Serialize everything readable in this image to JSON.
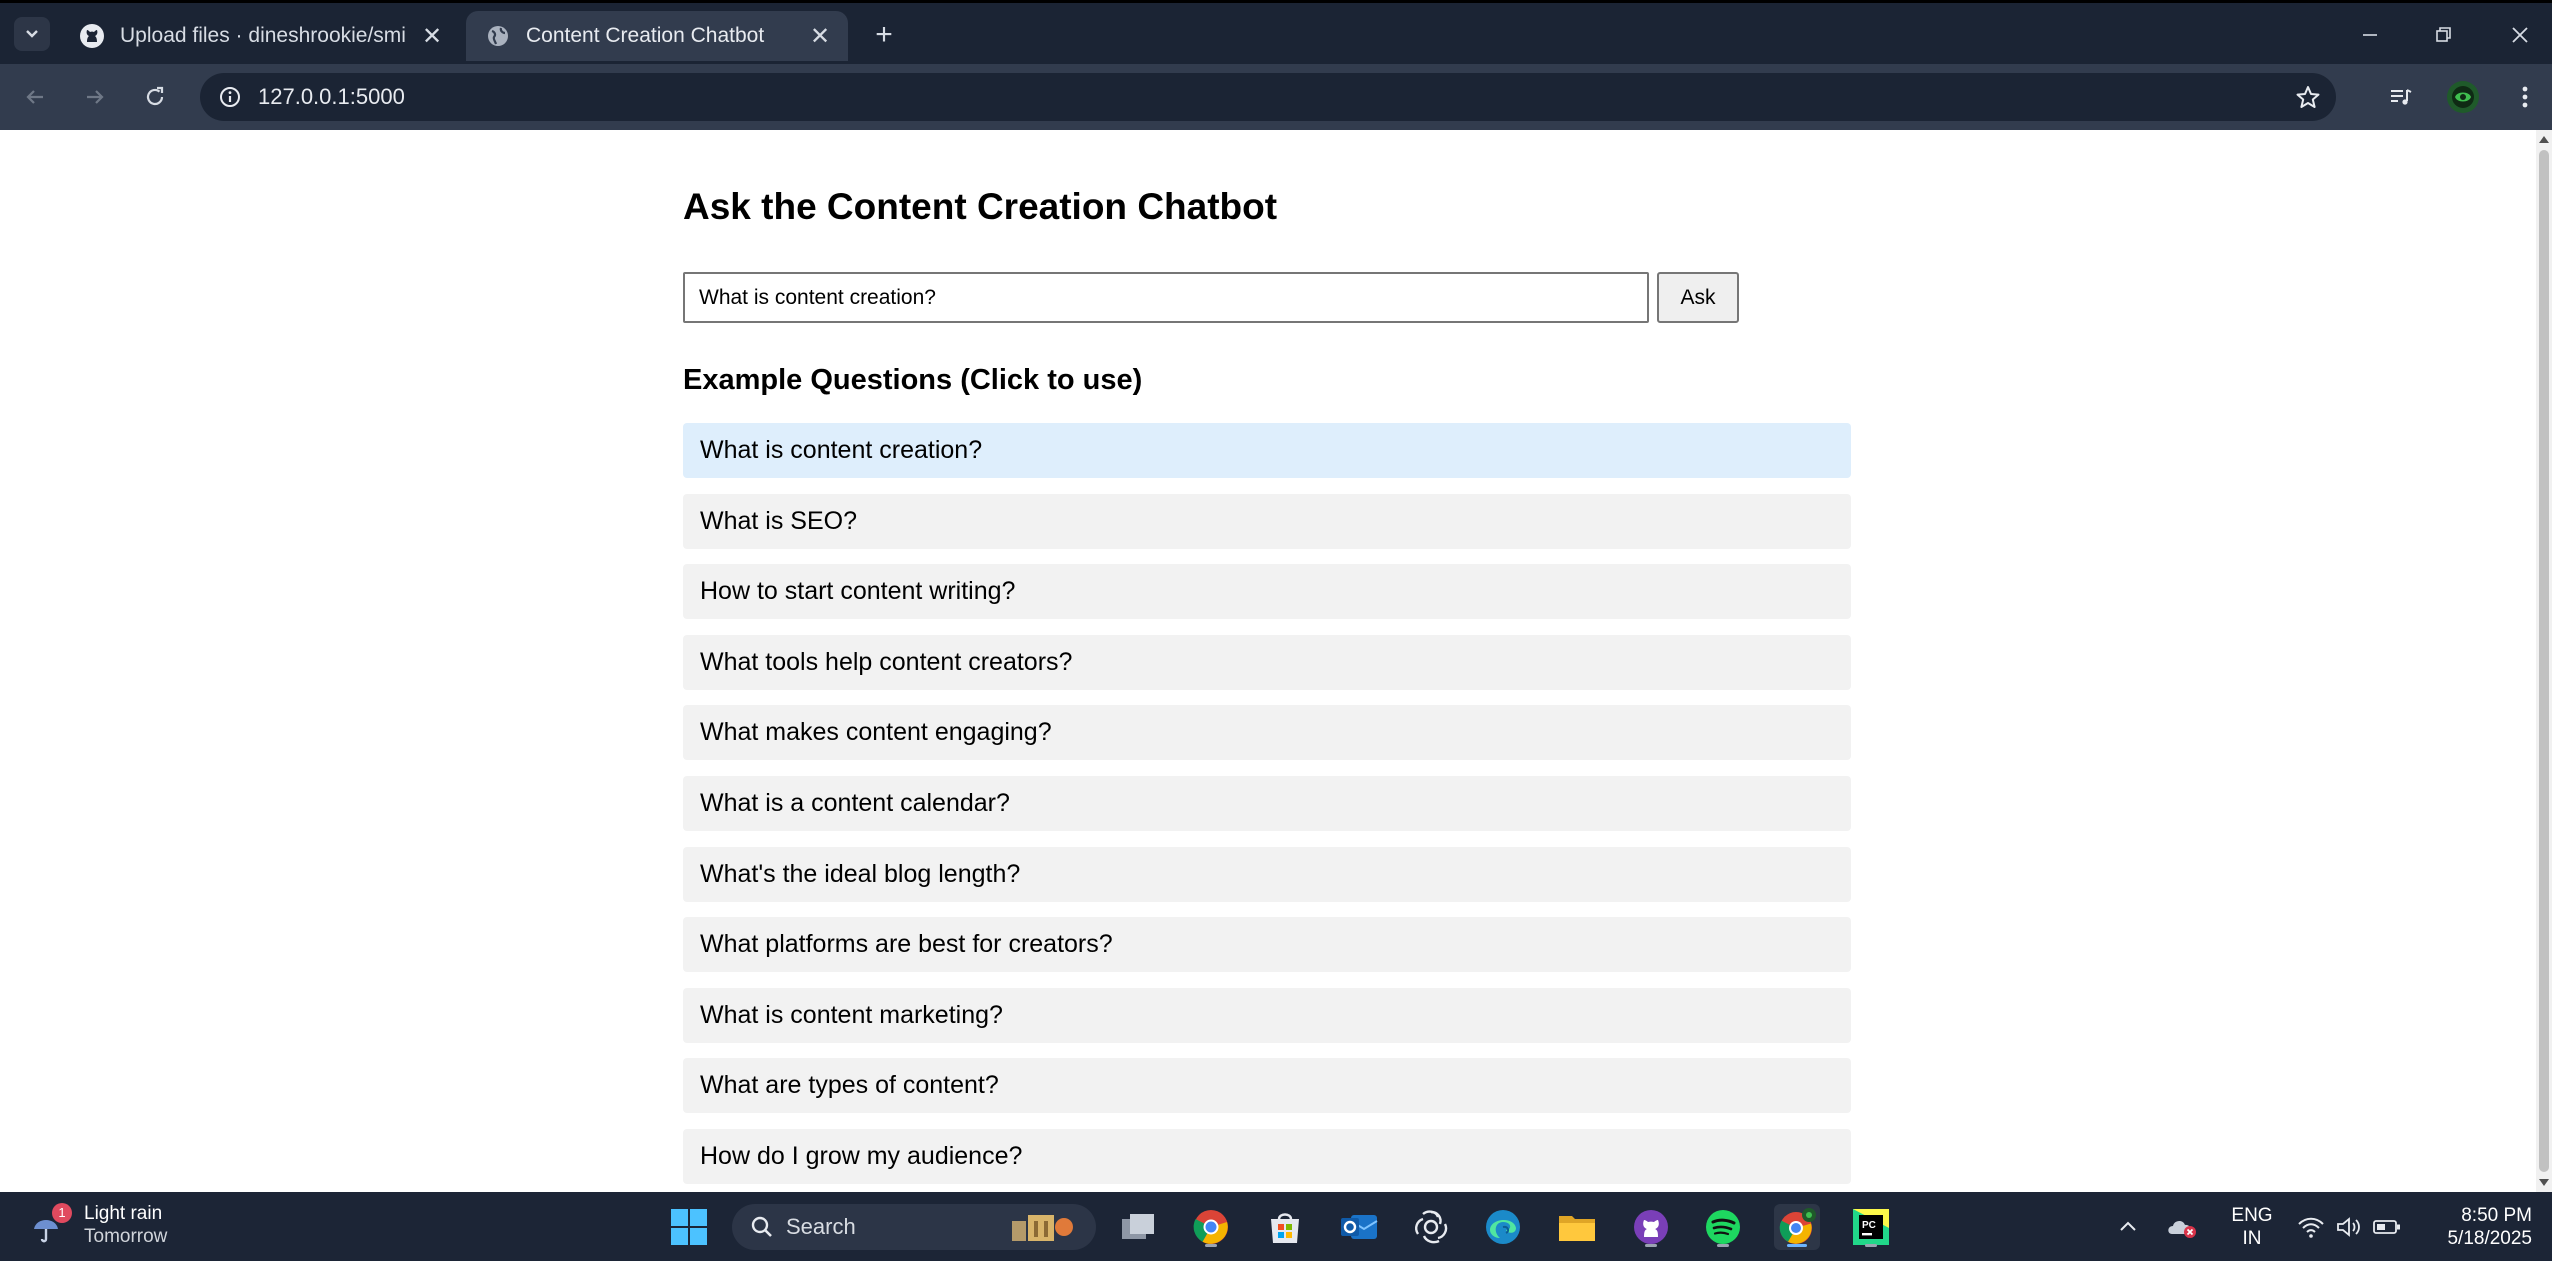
{
  "browser": {
    "tabs": [
      {
        "title": "Upload files · dineshrookie/smi",
        "active": false
      },
      {
        "title": "Content Creation Chatbot",
        "active": true
      }
    ],
    "url": "127.0.0.1:5000"
  },
  "page": {
    "heading": "Ask the Content Creation Chatbot",
    "question_value": "What is content creation?",
    "ask_label": "Ask",
    "examples_heading": "Example Questions (Click to use)",
    "examples": [
      "What is content creation?",
      "What is SEO?",
      "How to start content writing?",
      "What tools help content creators?",
      "What makes content engaging?",
      "What is a content calendar?",
      "What's the ideal blog length?",
      "What platforms are best for creators?",
      "What is content marketing?",
      "What are types of content?",
      "How do I grow my audience?"
    ],
    "hovered_example_index": 0
  },
  "taskbar": {
    "weather_badge": "1",
    "weather_title": "Light rain",
    "weather_sub": "Tomorrow",
    "search_label": "Search",
    "lang_top": "ENG",
    "lang_bottom": "IN",
    "time": "8:50 PM",
    "date": "5/18/2025"
  },
  "colors": {
    "tabstrip_bg": "#1b2434",
    "toolbar_bg": "#323c4e",
    "hover_example_bg": "#deeefc",
    "example_bg": "#f2f2f2",
    "taskbar_bg": "#1c2536"
  }
}
